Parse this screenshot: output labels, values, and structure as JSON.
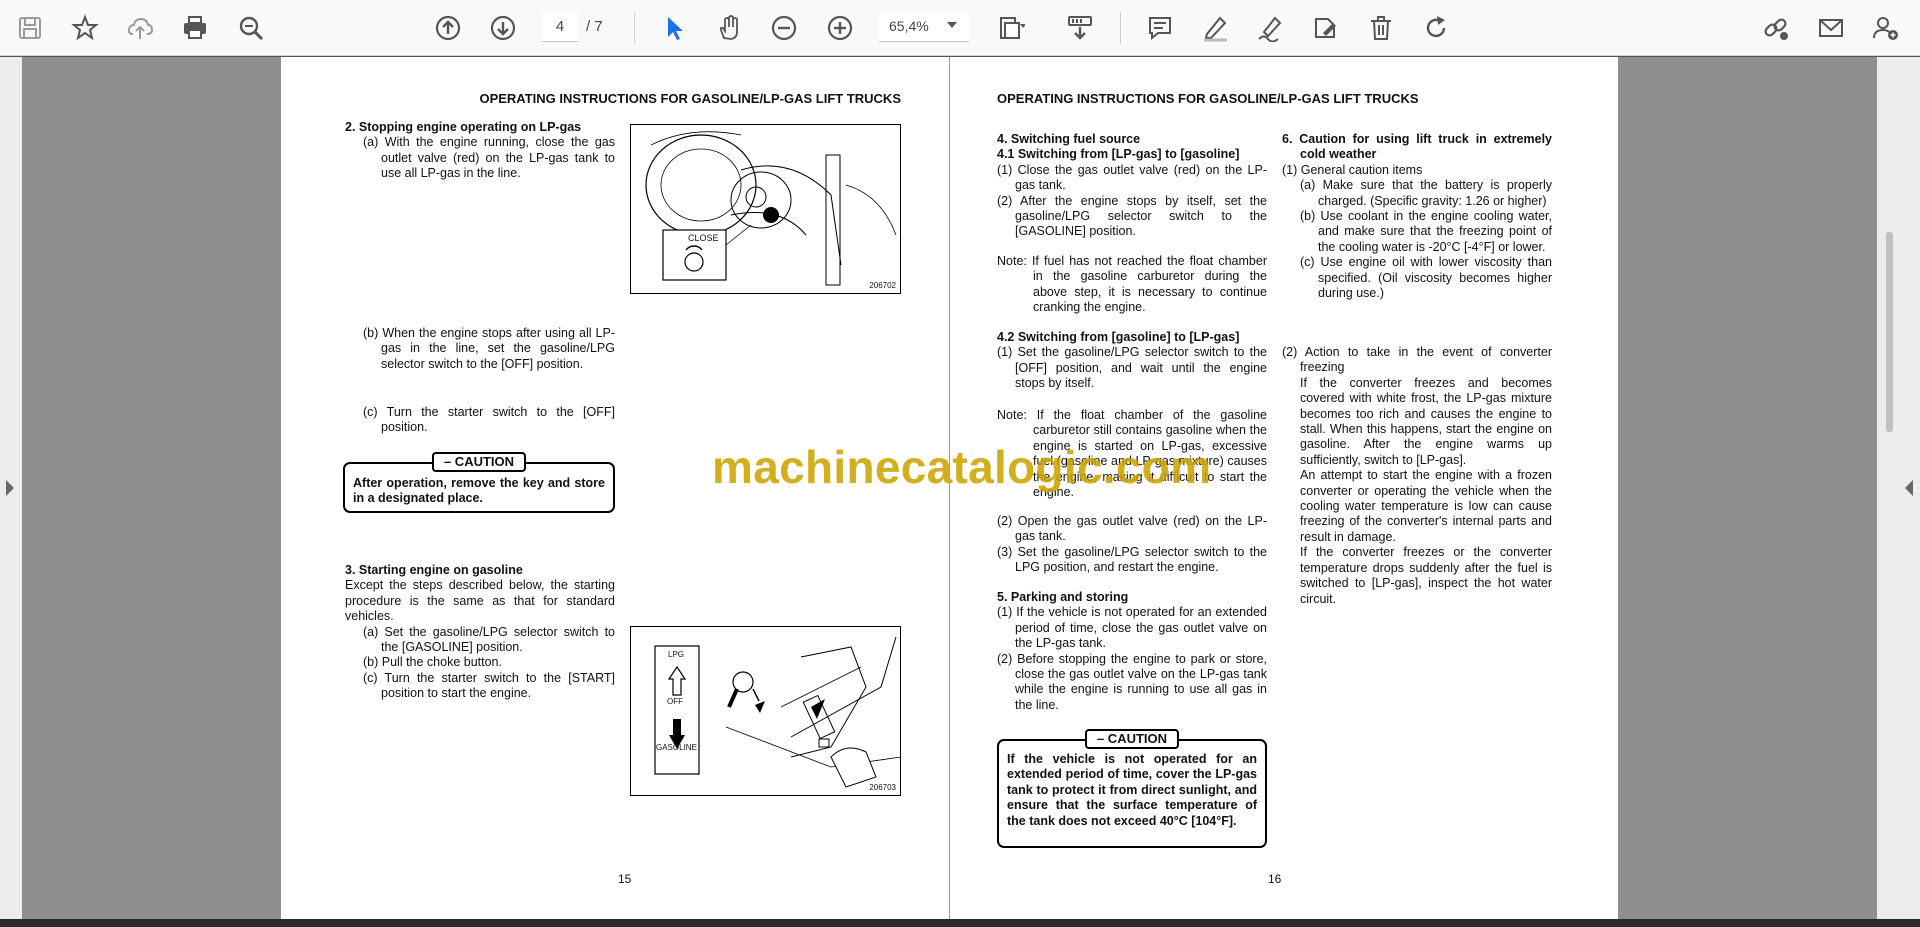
{
  "toolbar": {
    "page_current": "4",
    "page_total": "/ 7",
    "zoom": "65,4%"
  },
  "icons": {
    "save": "save-icon",
    "bookmark": "star-icon",
    "upload": "cloud-upload-icon",
    "print": "print-icon",
    "find": "zoom-search-icon",
    "prev": "arrow-up-circle-icon",
    "next": "arrow-down-circle-icon",
    "select": "cursor-arrow-icon",
    "hand": "hand-icon",
    "zoom_out": "zoom-out-icon",
    "zoom_in": "zoom-in-icon",
    "fit": "page-fit-icon",
    "scroll": "scroll-mode-icon",
    "comment": "comment-icon",
    "highlight": "highlight-pen-icon",
    "sign": "sign-icon",
    "stamp": "stamp-icon",
    "delete": "trash-icon",
    "rotate": "rotate-icon",
    "share": "share-link-icon",
    "mail": "mail-icon",
    "user": "add-user-icon"
  },
  "watermark": "machinecatalogic.com",
  "left_page": {
    "header": "OPERATING INSTRUCTIONS FOR GASOLINE/LP-GAS LIFT TRUCKS",
    "s2_title": "2. Stopping engine operating on LP-gas",
    "s2_a": "(a) With the engine running, close the gas outlet valve (red) on the LP-gas tank to use all LP-gas in the line.",
    "s2_b": "(b) When the engine stops after using all LP-gas in the line, set the gasoline/LPG selector switch to the [OFF] position.",
    "s2_c": "(c) Turn the starter switch to the [OFF] position.",
    "caution1_label": "– CAUTION",
    "caution1_text": "After operation, remove the key and store in a designated place.",
    "fig1_label": "CLOSE",
    "fig1_num": "206702",
    "s3_title": "3. Starting engine on gasoline",
    "s3_intro": "Except the steps described below, the starting procedure is the same as that for standard vehicles.",
    "s3_a": "(a) Set the gasoline/LPG selector switch to the [GASOLINE] position.",
    "s3_b": "(b) Pull the choke button.",
    "s3_c": "(c) Turn the starter switch to the [START] position to start the engine.",
    "fig2_lpg": "LPG",
    "fig2_off": "OFF",
    "fig2_gas": "GASOLINE",
    "fig2_num": "206703",
    "page_number": "15"
  },
  "right_page": {
    "header": "OPERATING INSTRUCTIONS FOR GASOLINE/LP-GAS LIFT TRUCKS",
    "s4_title": "4. Switching fuel source",
    "s41_title": "4.1 Switching from [LP-gas] to [gasoline]",
    "s41_1": "(1) Close the gas outlet valve (red) on the LP-gas tank.",
    "s41_2": "(2) After the engine stops by itself, set the gasoline/LPG selector switch to the [GASOLINE] position.",
    "note1": "Note: If fuel has not reached the float chamber in the gasoline carburetor during the above step, it is necessary to continue cranking the engine.",
    "s42_title": "4.2 Switching from [gasoline] to [LP-gas]",
    "s42_1": "(1) Set the gasoline/LPG selector switch to the [OFF] position, and wait until the engine stops by itself.",
    "note2": "Note: If the float chamber of the gasoline carburetor still contains gasoline when the engine is started on LP-gas, excessive fuel (gasoline and LP-gas mixture) causes the engine, making it difficult to start the engine.",
    "s42_2": "(2) Open the gas outlet valve (red) on the LP-gas tank.",
    "s42_3": "(3) Set the gasoline/LPG selector switch to the LPG position, and restart the engine.",
    "s5_title": "5. Parking and storing",
    "s5_1": "(1) If the vehicle is not operated for an extended period of time, close the gas outlet valve on the LP-gas tank.",
    "s5_2": "(2) Before stopping the engine to park or store, close the gas outlet valve on the LP-gas tank while the engine is running to use all gas in the line.",
    "caution2_label": "– CAUTION",
    "caution2_text": "If the vehicle is not operated for an extended period of time, cover the LP-gas tank to protect it from direct sunlight, and ensure that the surface temperature of the tank does not exceed 40°C [104°F].",
    "s6_title": "6. Caution for using lift truck in extremely cold weather",
    "s6_1": "(1) General caution items",
    "s6_1a": "(a) Make sure that the battery is properly charged. (Specific gravity: 1.26 or higher)",
    "s6_1b": "(b) Use coolant in the engine cooling water, and make sure that the freezing point of the cooling water is -20°C [-4°F] or lower.",
    "s6_1c": "(c) Use engine oil with lower viscosity than specified. (Oil viscosity becomes higher during use.)",
    "s6_2": "(2) Action to take in the event of converter freezing",
    "s6_2p1": "If the converter freezes and becomes covered with white frost, the LP-gas mixture becomes too rich and causes the engine to stall. When this happens, start the engine on gasoline. After the engine warms up sufficiently, switch to [LP-gas].",
    "s6_2p2": "An attempt to start the engine with a frozen converter or operating the vehicle when the cooling water temperature is low can cause freezing of the converter's internal parts and result in damage.",
    "s6_2p3": "If the converter freezes or the converter temperature drops suddenly after the fuel is switched to [LP-gas], inspect the hot water circuit.",
    "page_number": "16"
  }
}
